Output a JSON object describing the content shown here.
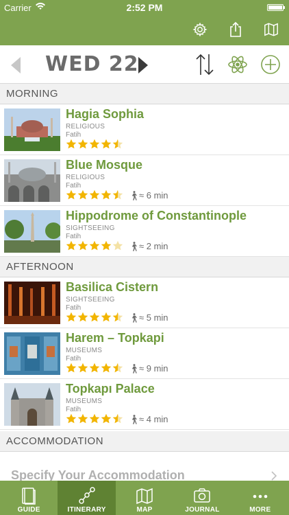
{
  "status": {
    "carrier": "Carrier",
    "time": "2:52 PM"
  },
  "header": {
    "date": "WED 22"
  },
  "sections": [
    {
      "title": "MORNING",
      "items": [
        {
          "title": "Hagia Sophia",
          "category": "RELIGIOUS",
          "location": "Fatih",
          "rating": 4.5,
          "walk": ""
        },
        {
          "title": "Blue Mosque",
          "category": "RELIGIOUS",
          "location": "Fatih",
          "rating": 4.5,
          "walk": "≈ 6 min"
        },
        {
          "title": "Hippodrome of Constantinople",
          "category": "SIGHTSEEING",
          "location": "Fatih",
          "rating": 4,
          "walk": "≈ 2 min"
        }
      ]
    },
    {
      "title": "AFTERNOON",
      "items": [
        {
          "title": "Basilica Cistern",
          "category": "SIGHTSEEING",
          "location": "Fatih",
          "rating": 4.5,
          "walk": "≈ 5 min"
        },
        {
          "title": "Harem – Topkapi",
          "category": "MUSEUMS",
          "location": "Fatih",
          "rating": 4.5,
          "walk": "≈ 9 min"
        },
        {
          "title": "Topkapı Palace",
          "category": "MUSEUMS",
          "location": "Fatih",
          "rating": 4.5,
          "walk": "≈ 4 min"
        }
      ]
    },
    {
      "title": "ACCOMMODATION",
      "placeholder": "Specify Your Accommodation"
    }
  ],
  "tabs": [
    {
      "label": "GUIDE",
      "icon": "book-icon",
      "active": false
    },
    {
      "label": "ITINERARY",
      "icon": "route-icon",
      "active": true
    },
    {
      "label": "MAP",
      "icon": "map-icon",
      "active": false
    },
    {
      "label": "JOURNAL",
      "icon": "camera-icon",
      "active": false
    },
    {
      "label": "MORE",
      "icon": "more-icon",
      "active": false
    }
  ],
  "colors": {
    "brand": "#7fa34f",
    "active_tab": "#5f8233",
    "title_green": "#6f9a3d",
    "star": "#f2b500"
  }
}
